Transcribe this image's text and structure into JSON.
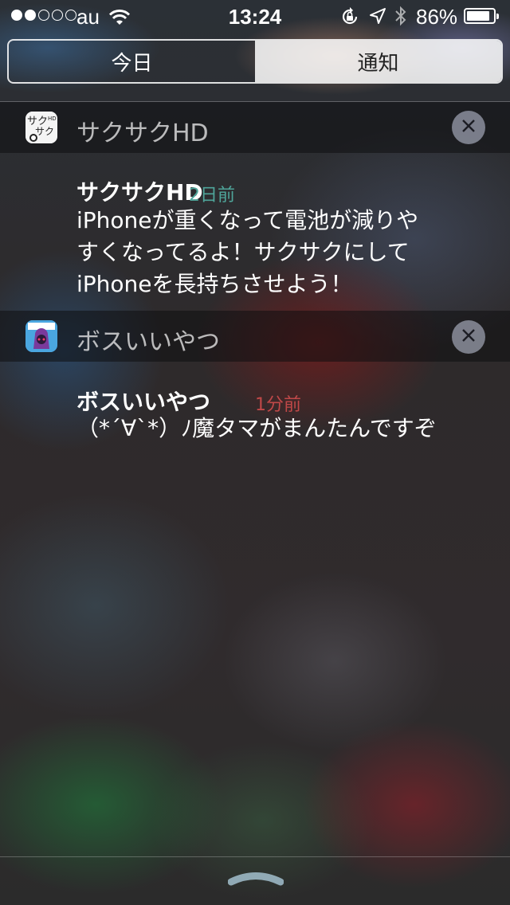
{
  "status_bar": {
    "carrier": "au",
    "time": "13:24",
    "battery_percent": "86%",
    "battery_level": 0.86,
    "signal_bars": 2,
    "signal_total": 5
  },
  "tabs": {
    "today": "今日",
    "notifications": "通知",
    "selected": "通知"
  },
  "groups": [
    {
      "app_name": "サクサクHD",
      "icon": "sakusaku-hd-app-icon",
      "notification": {
        "title": "サクサクHD",
        "time": "2日前",
        "time_color": "#4fa59a",
        "lines": [
          "iPhoneが重くなって電池が減りや",
          "すくなってるよ！サクサクにして",
          "iPhoneを長持ちさせよう！"
        ]
      }
    },
    {
      "app_name": "ボスいいやつ",
      "icon": "boss-iiyatsu-app-icon",
      "notification": {
        "title": "ボスいいやつ",
        "time": "1分前",
        "time_color": "#c04848",
        "lines": [
          "（*´∀`*）ﾉ魔タマがまんたんですぞ"
        ]
      }
    }
  ],
  "icons": {
    "close": "close-icon",
    "grabber": "chevron-up-icon"
  }
}
